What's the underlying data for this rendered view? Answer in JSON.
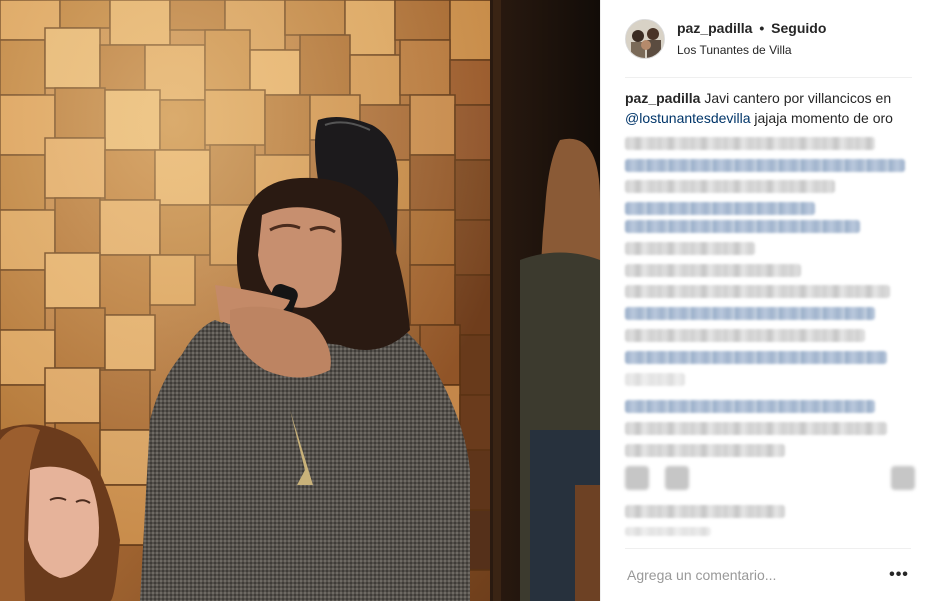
{
  "header": {
    "username": "paz_padilla",
    "separator": "•",
    "follow_state": "Seguido",
    "location": "Los Tunantes de Villa"
  },
  "caption": {
    "username": "paz_padilla",
    "text_before": "Javi cantero por villancicos en",
    "mention": "@lostunantesdevilla",
    "text_after": "jajaja momento de oro"
  },
  "comment_box": {
    "placeholder": "Agrega un comentario..."
  },
  "more_options": {
    "label": "•••"
  },
  "icons": {
    "more": "ellipsis-icon",
    "avatar": "profile-photo"
  },
  "colors": {
    "mention": "#003569",
    "text": "#262626",
    "placeholder": "#999999",
    "divider": "#efefef"
  }
}
